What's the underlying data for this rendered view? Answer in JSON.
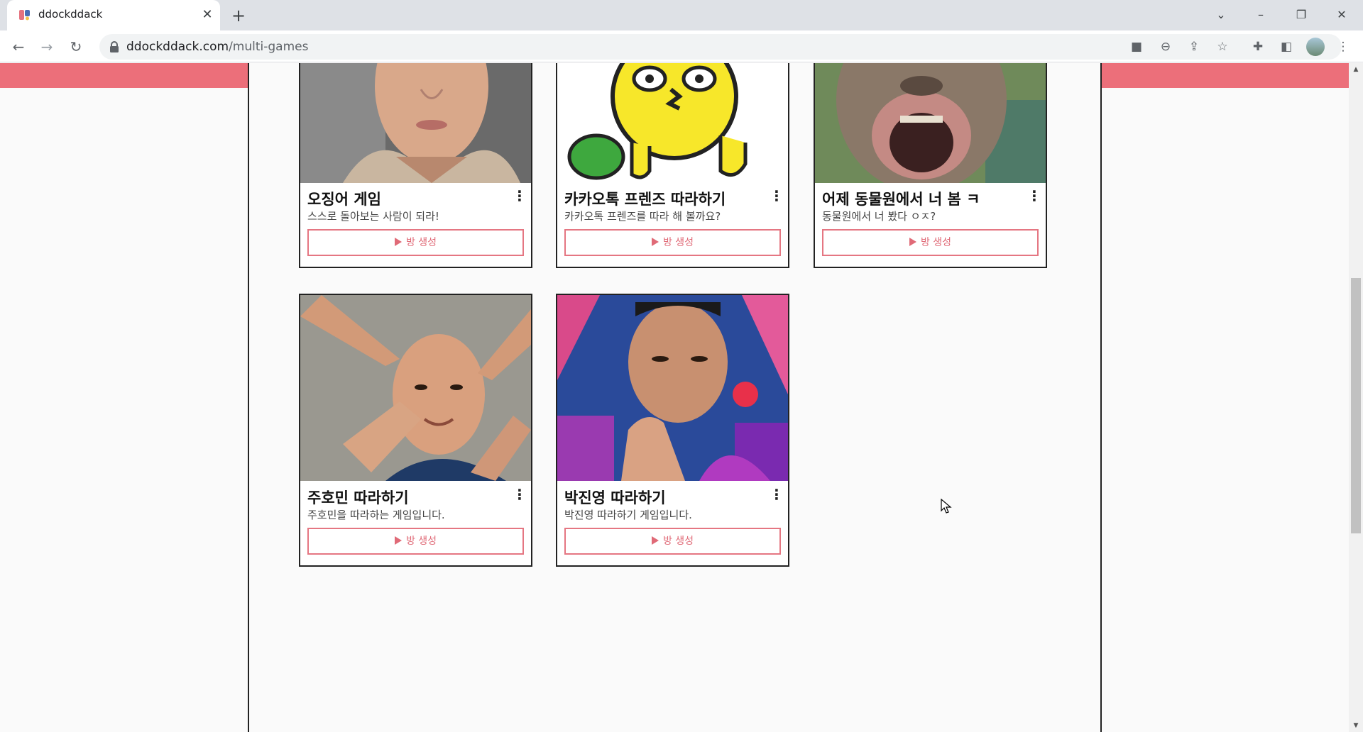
{
  "browser": {
    "tab_title": "ddockddack",
    "url_domain": "ddockddack.com",
    "url_path": "/multi-games"
  },
  "games": [
    {
      "title": "오징어 게임",
      "description": "스스로 돌아보는 사람이 되라!",
      "button": "방 생성",
      "image_desc": "man-portrait"
    },
    {
      "title": "카카오톡 프렌즈 따라하기",
      "description": "카카오톡 프렌즈를 따라 해 볼까요?",
      "button": "방 생성",
      "image_desc": "yellow-character"
    },
    {
      "title": "어제 동물원에서 너 봄 ㅋ",
      "description": "동물원에서 너 봤다 ㅇㅈ?",
      "button": "방 생성",
      "image_desc": "monkey-face"
    },
    {
      "title": "주호민 따라하기",
      "description": "주호민을 따라하는 게임입니다.",
      "button": "방 생성",
      "image_desc": "hand-frame-portrait"
    },
    {
      "title": "박진영 따라하기",
      "description": "박진영 따라하기 게임입니다.",
      "button": "방 생성",
      "image_desc": "finger-heart-portrait"
    }
  ],
  "colors": {
    "accent": "#ec6f7a",
    "button_border": "#e57682",
    "card_border": "#222222"
  }
}
